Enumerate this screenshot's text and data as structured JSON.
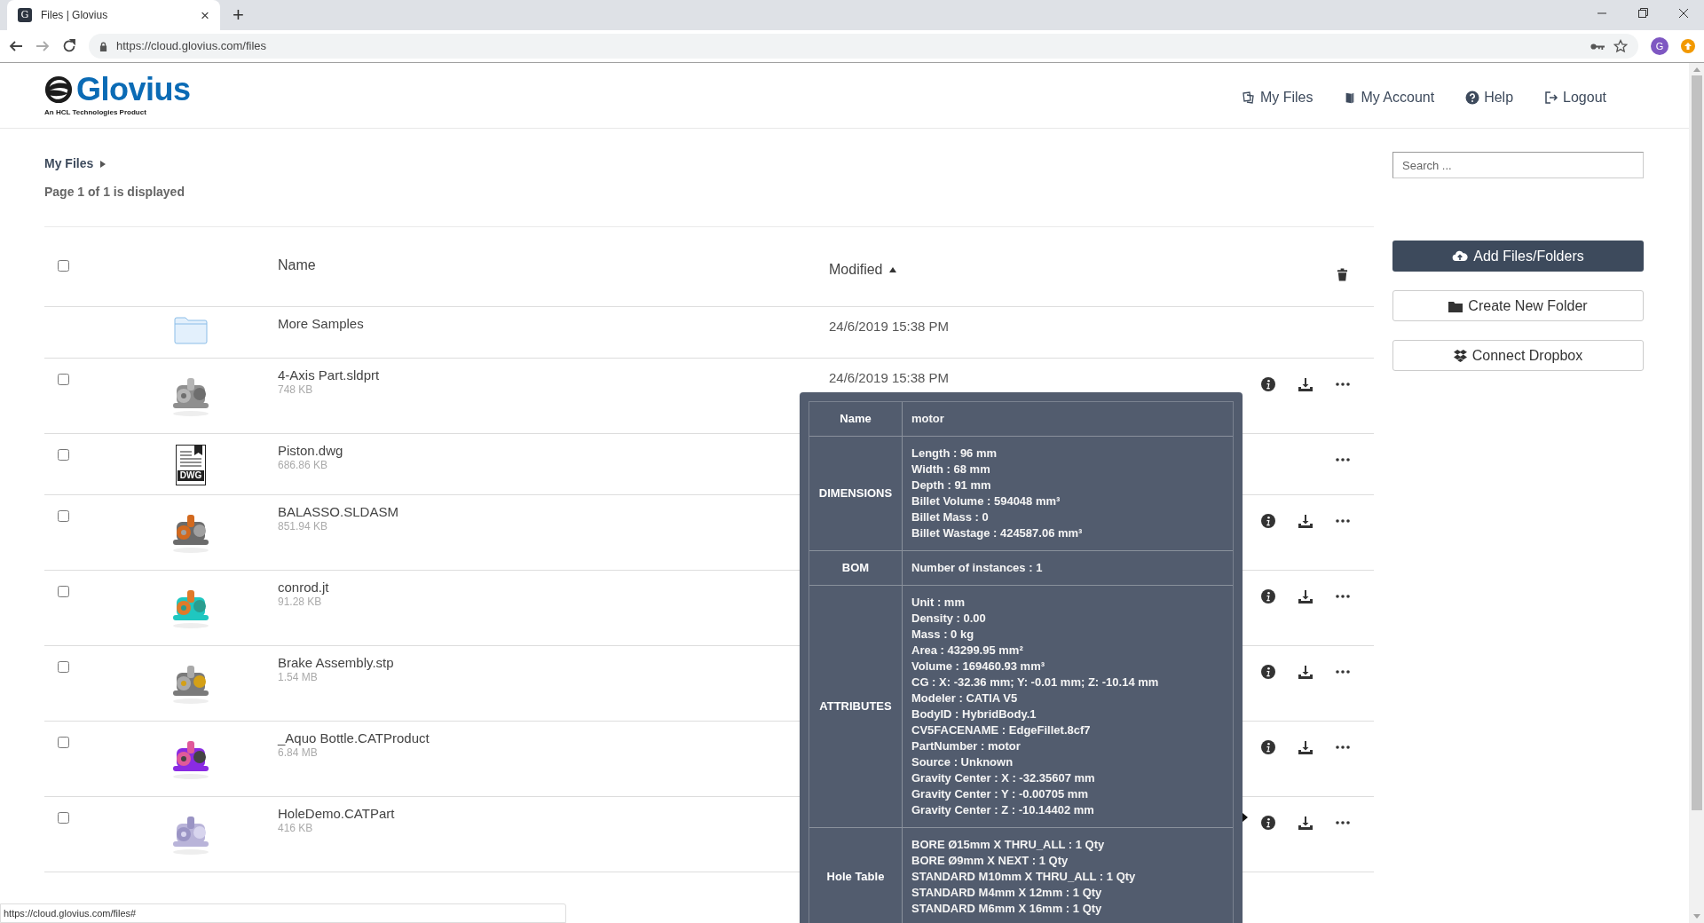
{
  "browser": {
    "tab": {
      "favicon": "G",
      "title": "Files | Glovius",
      "close": "×"
    },
    "new_tab": "+",
    "url": "https://cloud.glovius.com/files",
    "profile": "G"
  },
  "header": {
    "logo": "Glovius",
    "tagline": "An HCL Technologies Product",
    "nav": [
      {
        "kind": "files",
        "label": "My Files"
      },
      {
        "kind": "book",
        "label": "My Account"
      },
      {
        "kind": "help",
        "label": "Help"
      },
      {
        "kind": "logout",
        "label": "Logout"
      }
    ]
  },
  "breadcrumb": {
    "label": "My Files"
  },
  "page_info": "Page 1 of 1 is displayed",
  "search": {
    "placeholder": "Search ..."
  },
  "table": {
    "header": {
      "checked": false,
      "columns": [
        {
          "label": "Name",
          "sorted": false
        },
        {
          "label": "Modified",
          "sorted": true
        }
      ]
    },
    "rows": [
      {
        "kind": "folder",
        "name": "More Samples",
        "modified": "24/6/2019 15:38 PM"
      },
      {
        "kind": "picture",
        "name": "4-Axis Part.sldprt",
        "size": "748 KB",
        "modified": "24/6/2019 15:38 PM",
        "checked": false,
        "info": true,
        "download": true
      },
      {
        "kind": "document",
        "thumb_label": "DWG",
        "name": "Piston.dwg",
        "size": "686.86 KB",
        "checked": false,
        "info": false,
        "download": false
      },
      {
        "kind": "picture",
        "name": "BALASSO.SLDASM",
        "size": "851.94 KB",
        "checked": false,
        "info": true,
        "download": true
      },
      {
        "kind": "picture",
        "name": "conrod.jt",
        "size": "91.28 KB",
        "checked": false,
        "info": true,
        "download": true
      },
      {
        "kind": "picture",
        "name": "Brake Assembly.stp",
        "size": "1.54 MB",
        "checked": false,
        "info": true,
        "download": true
      },
      {
        "kind": "picture",
        "name": "_Aquo Bottle.CATProduct",
        "size": "6.84 MB",
        "checked": false,
        "info": true,
        "download": true
      },
      {
        "kind": "picture",
        "name": "HoleDemo.CATPart",
        "size": "416 KB",
        "checked": false,
        "info": true,
        "download": true
      }
    ]
  },
  "actions": [
    {
      "kind": "upload",
      "label": "Add Files/Folders",
      "primary": true
    },
    {
      "kind": "folder",
      "label": "Create New Folder",
      "primary": false
    },
    {
      "kind": "dropbox",
      "label": "Connect Dropbox",
      "primary": false
    }
  ],
  "tooltip": {
    "rows": [
      {
        "label": "Name",
        "lines": [
          "motor"
        ]
      },
      {
        "label": "DIMENSIONS",
        "lines": [
          "Length : 96 mm",
          "Width : 68 mm",
          "Depth : 91 mm",
          "Billet Volume : 594048 mm³",
          "Billet Mass : 0",
          "Billet Wastage : 424587.06 mm³"
        ]
      },
      {
        "label": "BOM",
        "lines": [
          "Number of instances : 1"
        ]
      },
      {
        "label": "ATTRIBUTES",
        "lines": [
          "Unit : mm",
          "Density : 0.00",
          "Mass : 0 kg",
          "Area : 43299.95 mm²",
          "Volume : 169460.93 mm³",
          "CG : X: -32.36 mm; Y: -0.01 mm; Z: -10.14 mm",
          "Modeler : CATIA V5",
          "BodyID : HybridBody.1",
          "CV5FACENAME : EdgeFillet.8cf7",
          "PartNumber : motor",
          "Source : Unknown",
          "Gravity Center : X : -32.35607 mm",
          "Gravity Center : Y : -0.00705 mm",
          "Gravity Center : Z : -10.14402 mm"
        ]
      },
      {
        "label": "Hole Table",
        "lines": [
          "BORE Ø15mm X THRU_ALL : 1 Qty",
          "BORE Ø9mm X NEXT : 1 Qty",
          "STANDARD M10mm X THRU_ALL : 1 Qty",
          "STANDARD M4mm X 12mm : 1 Qty",
          "STANDARD M6mm X 16mm : 1 Qty"
        ]
      }
    ]
  },
  "status_bar": "https://cloud.glovius.com/files#"
}
